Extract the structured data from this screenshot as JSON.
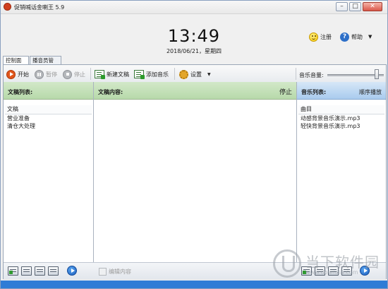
{
  "window": {
    "title": "促销喊话金喇王 5.9"
  },
  "clock": {
    "time": "13:49",
    "date": "2018/06/21，星期四"
  },
  "top_links": {
    "register": "注册",
    "help": "帮助"
  },
  "tabs": [
    {
      "label": "控制面板"
    },
    {
      "label": "播音员管理"
    }
  ],
  "toolbar": {
    "start": "开始",
    "pause": "暂停",
    "stop": "停止",
    "new_text": "新建文稿",
    "add_music": "添加音乐",
    "settings": "设置",
    "volume_label": "音乐音量:",
    "volume_level": 0.9
  },
  "text_list": {
    "title": "文稿列表:",
    "column": "文稿",
    "items": [
      "营业准备",
      "清仓大处理"
    ]
  },
  "content": {
    "title": "文稿内容:",
    "status": "停止",
    "edit_button": "编辑内容"
  },
  "music_list": {
    "title": "音乐列表:",
    "mode": "顺序播放",
    "column": "曲目",
    "items": [
      "动感背景音乐演示.mp3",
      "轻快背景音乐演示.mp3"
    ]
  },
  "watermark": {
    "text": "当下软件园",
    "sub": "www.downxia.com"
  },
  "colors": {
    "accent": "#2f7cd6",
    "text_panel_head": "#b7d9aa",
    "music_panel_head": "#a9cbee",
    "play": "#e0561c"
  }
}
